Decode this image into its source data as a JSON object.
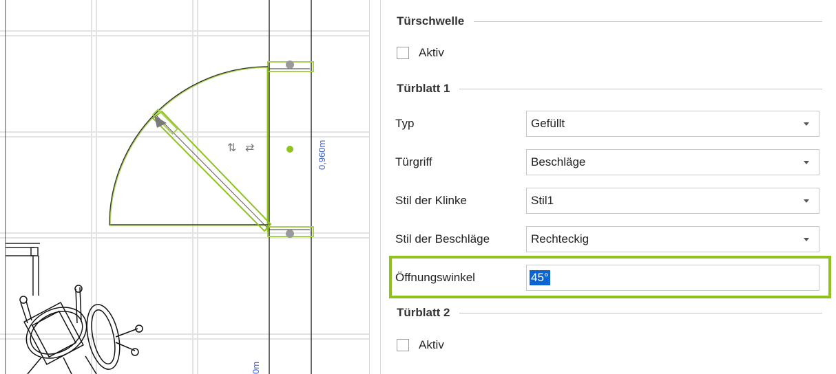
{
  "canvas": {
    "dimension_label": "0,960m",
    "dimension_label_partial": "0m",
    "flip_vertical_glyph": "⇅",
    "flip_horizontal_glyph": "⇄",
    "accent_color": "#8fc21c",
    "dimension_color": "#3a5fe0"
  },
  "panel": {
    "threshold": {
      "title": "Türschwelle",
      "active_label": "Aktiv",
      "active_checked": false
    },
    "leaf1": {
      "title": "Türblatt 1",
      "type": {
        "label": "Typ",
        "value": "Gefüllt"
      },
      "handle": {
        "label": "Türgriff",
        "value": "Beschläge"
      },
      "handle_style": {
        "label": "Stil der Klinke",
        "value": "Stil1"
      },
      "hardware_style": {
        "label": "Stil der Beschläge",
        "value": "Rechteckig"
      },
      "opening_angle": {
        "label": "Öffnungswinkel",
        "value": "45°"
      }
    },
    "leaf2": {
      "title": "Türblatt 2",
      "active_label": "Aktiv",
      "active_checked": false
    },
    "focus_color": "#8fc21c",
    "selection_color": "#0a64d2"
  }
}
